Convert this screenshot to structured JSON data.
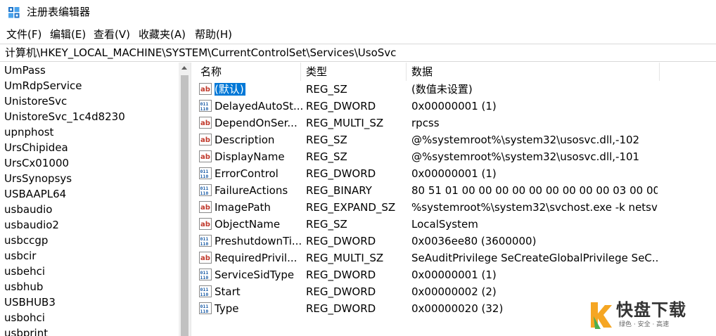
{
  "window": {
    "title": "注册表编辑器"
  },
  "menu": [
    "文件(F)",
    "编辑(E)",
    "查看(V)",
    "收藏夹(A)",
    "帮助(H)"
  ],
  "address": "计算机\\HKEY_LOCAL_MACHINE\\SYSTEM\\CurrentControlSet\\Services\\UsoSvc",
  "tree": [
    "UmPass",
    "UmRdpService",
    "UnistoreSvc",
    "UnistoreSvc_1c4d8230",
    "upnphost",
    "UrsChipidea",
    "UrsCx01000",
    "UrsSynopsys",
    "USBAAPL64",
    "usbaudio",
    "usbaudio2",
    "usbccgp",
    "usbcir",
    "usbehci",
    "usbhub",
    "USBHUB3",
    "usbohci",
    "usbprint"
  ],
  "columns": {
    "name": "名称",
    "type": "类型",
    "data": "数据"
  },
  "values": [
    {
      "icon": "string-value-icon",
      "name": "(默认)",
      "type": "REG_SZ",
      "data": "(数值未设置)"
    },
    {
      "icon": "binary-value-icon",
      "name": "DelayedAutoSt...",
      "type": "REG_DWORD",
      "data": "0x00000001 (1)"
    },
    {
      "icon": "string-value-icon",
      "name": "DependOnSer...",
      "type": "REG_MULTI_SZ",
      "data": "rpcss"
    },
    {
      "icon": "string-value-icon",
      "name": "Description",
      "type": "REG_SZ",
      "data": "@%systemroot%\\system32\\usosvc.dll,-102"
    },
    {
      "icon": "string-value-icon",
      "name": "DisplayName",
      "type": "REG_SZ",
      "data": "@%systemroot%\\system32\\usosvc.dll,-101"
    },
    {
      "icon": "binary-value-icon",
      "name": "ErrorControl",
      "type": "REG_DWORD",
      "data": "0x00000001 (1)"
    },
    {
      "icon": "binary-value-icon",
      "name": "FailureActions",
      "type": "REG_BINARY",
      "data": "80 51 01 00 00 00 00 00 00 00 00 00 03 00 00 ..."
    },
    {
      "icon": "string-value-icon",
      "name": "ImagePath",
      "type": "REG_EXPAND_SZ",
      "data": "%systemroot%\\system32\\svchost.exe -k netsv..."
    },
    {
      "icon": "string-value-icon",
      "name": "ObjectName",
      "type": "REG_SZ",
      "data": "LocalSystem"
    },
    {
      "icon": "binary-value-icon",
      "name": "PreshutdownTi...",
      "type": "REG_DWORD",
      "data": "0x0036ee80 (3600000)"
    },
    {
      "icon": "string-value-icon",
      "name": "RequiredPrivil...",
      "type": "REG_MULTI_SZ",
      "data": "SeAuditPrivilege SeCreateGlobalPrivilege SeC..."
    },
    {
      "icon": "binary-value-icon",
      "name": "ServiceSidType",
      "type": "REG_DWORD",
      "data": "0x00000001 (1)"
    },
    {
      "icon": "binary-value-icon",
      "name": "Start",
      "type": "REG_DWORD",
      "data": "0x00000002 (2)"
    },
    {
      "icon": "binary-value-icon",
      "name": "Type",
      "type": "REG_DWORD",
      "data": "0x00000020 (32)"
    }
  ],
  "watermark": {
    "main": "快盘下载",
    "sub": "绿色 · 安全 · 高速",
    "colors": {
      "accent": "#f5a623",
      "green": "#4caf50",
      "text": "#333333"
    }
  },
  "colors": {
    "selection": "#0078d7",
    "string_icon": "#c0392b",
    "binary_icon": "#1f5fa8"
  }
}
